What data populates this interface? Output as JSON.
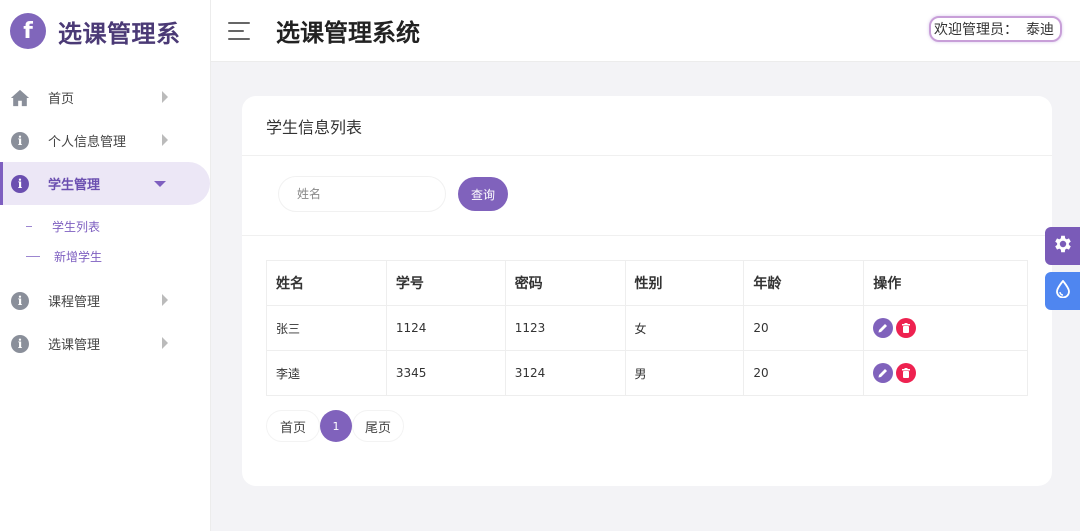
{
  "app": {
    "logo_letter": "f",
    "logo_text": "选课管理系"
  },
  "header": {
    "title": "选课管理系统",
    "welcome_label": "欢迎管理员：",
    "username": "泰迪"
  },
  "sidebar": {
    "items": [
      {
        "label": "首页",
        "icon": "home-icon"
      },
      {
        "label": "个人信息管理",
        "icon": "info-icon"
      },
      {
        "label": "学生管理",
        "icon": "info-icon",
        "active": true
      },
      {
        "label": "课程管理",
        "icon": "info-icon"
      },
      {
        "label": "选课管理",
        "icon": "info-icon"
      }
    ],
    "submenu": [
      {
        "label": "学生列表"
      },
      {
        "label": "新增学生"
      }
    ]
  },
  "card": {
    "title": "学生信息列表",
    "search": {
      "placeholder": "姓名",
      "button": "查询"
    },
    "table": {
      "headers": [
        "姓名",
        "学号",
        "密码",
        "性别",
        "年龄",
        "操作"
      ],
      "rows": [
        [
          "张三",
          "1124",
          "1123",
          "女",
          "20"
        ],
        [
          "李逵",
          "3345",
          "3124",
          "男",
          "20"
        ]
      ]
    },
    "pager": {
      "first": "首页",
      "current": "1",
      "last": "尾页"
    }
  },
  "colors": {
    "accent": "#8062bc",
    "danger": "#ee2250",
    "blue": "#4f86f0"
  },
  "float_buttons": [
    "gear-icon",
    "drop-icon"
  ]
}
